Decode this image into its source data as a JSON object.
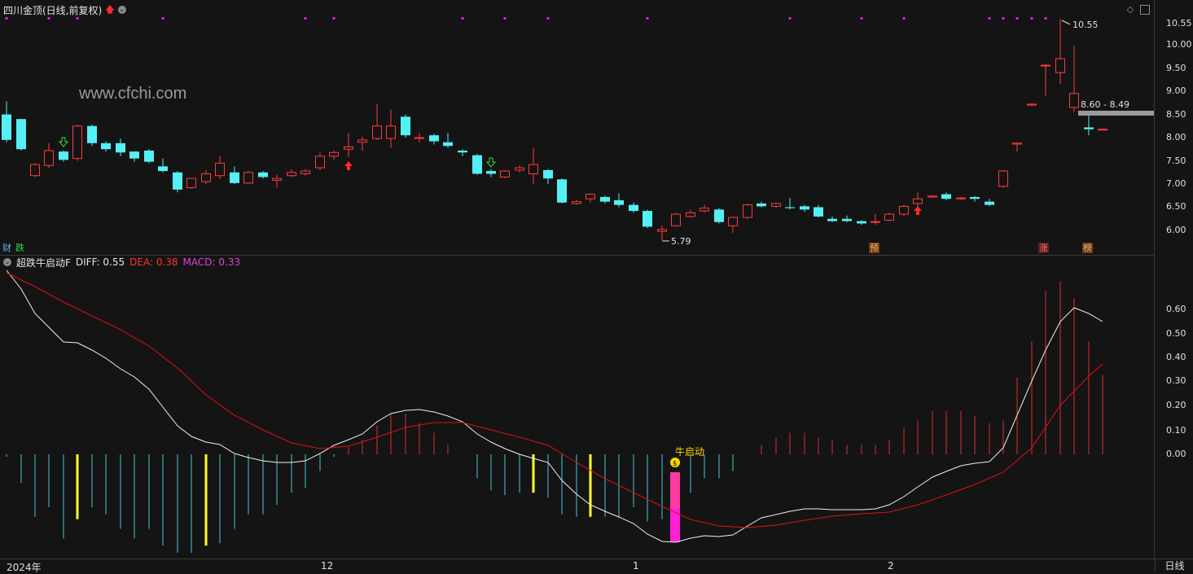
{
  "header": {
    "title": "四川金顶(日线,前复权)"
  },
  "watermark": "www.cfchi.com",
  "y_axis_price": [
    "10.55",
    "10.00",
    "9.50",
    "9.00",
    "8.50",
    "8.00",
    "7.50",
    "7.00",
    "6.50",
    "6.00"
  ],
  "y_axis_macd": [
    "0.60",
    "0.50",
    "0.40",
    "0.30",
    "0.20",
    "0.10",
    "0.00"
  ],
  "annotations": {
    "high": "10.55",
    "low": "5.79",
    "range": "8.60 - 8.49"
  },
  "tags": {
    "cai": "财",
    "die": "跌",
    "yu": "预",
    "zhang": "涨",
    "bang": "榜"
  },
  "indicator": {
    "name": "超跌牛启动F",
    "diff_label": "DIFF: 0.55",
    "dea_label": "DEA: 0.38",
    "macd_label": "MACD: 0.33",
    "signal_text": "牛启动",
    "signal_icon": "money-bag-icon"
  },
  "x_axis": [
    "2024年",
    "12",
    "1",
    "2"
  ],
  "period_button": "日线",
  "colors": {
    "up": "#ff3b3b",
    "down": "#54f0f5",
    "diff": "#ffffff",
    "dea": "#e01010",
    "macd_label": "#e040e0",
    "yellow_bar": "#ffff30",
    "signal": "#ff20d8"
  },
  "icons": [
    "chevron-down-icon",
    "red-up-arrow-icon",
    "green-down-arrow-icon",
    "diamond-icon",
    "panel-toggle-icon",
    "money-bag-icon"
  ]
}
